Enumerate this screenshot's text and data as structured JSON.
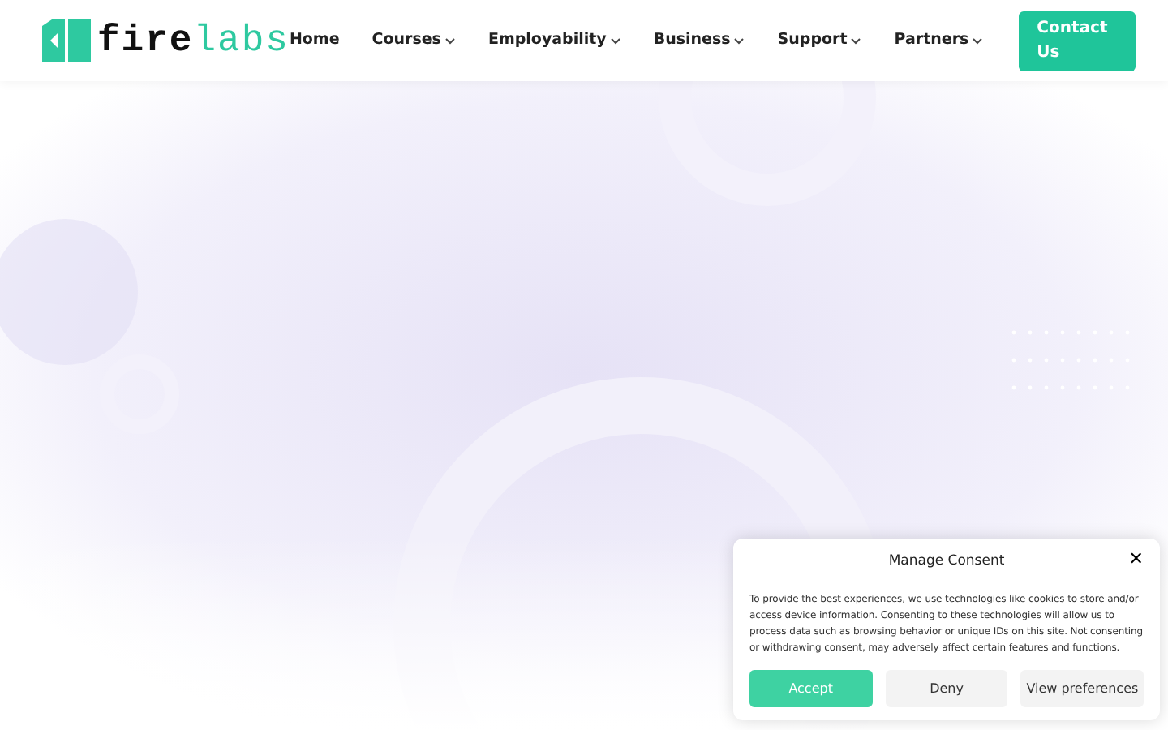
{
  "logo": {
    "dark_part": "fire",
    "light_part": "labs"
  },
  "nav": [
    {
      "label": "Home",
      "dropdown": false
    },
    {
      "label": "Courses",
      "dropdown": true
    },
    {
      "label": "Employability",
      "dropdown": true
    },
    {
      "label": "Business",
      "dropdown": true
    },
    {
      "label": "Support",
      "dropdown": true
    },
    {
      "label": "Partners",
      "dropdown": true
    }
  ],
  "contact_button": "Contact Us",
  "consent": {
    "title": "Manage Consent",
    "close": "✕",
    "text": "To provide the best experiences, we use technologies like cookies to store and/or access device information. Consenting to these technologies will allow us to process data such as browsing behavior or unique IDs on this site. Not consenting or withdrawing consent, may adversely affect certain features and functions.",
    "buttons": [
      {
        "label": "Accept",
        "kind": "primary"
      },
      {
        "label": "Deny",
        "kind": "secondary"
      },
      {
        "label": "View preferences",
        "kind": "secondary"
      }
    ]
  }
}
